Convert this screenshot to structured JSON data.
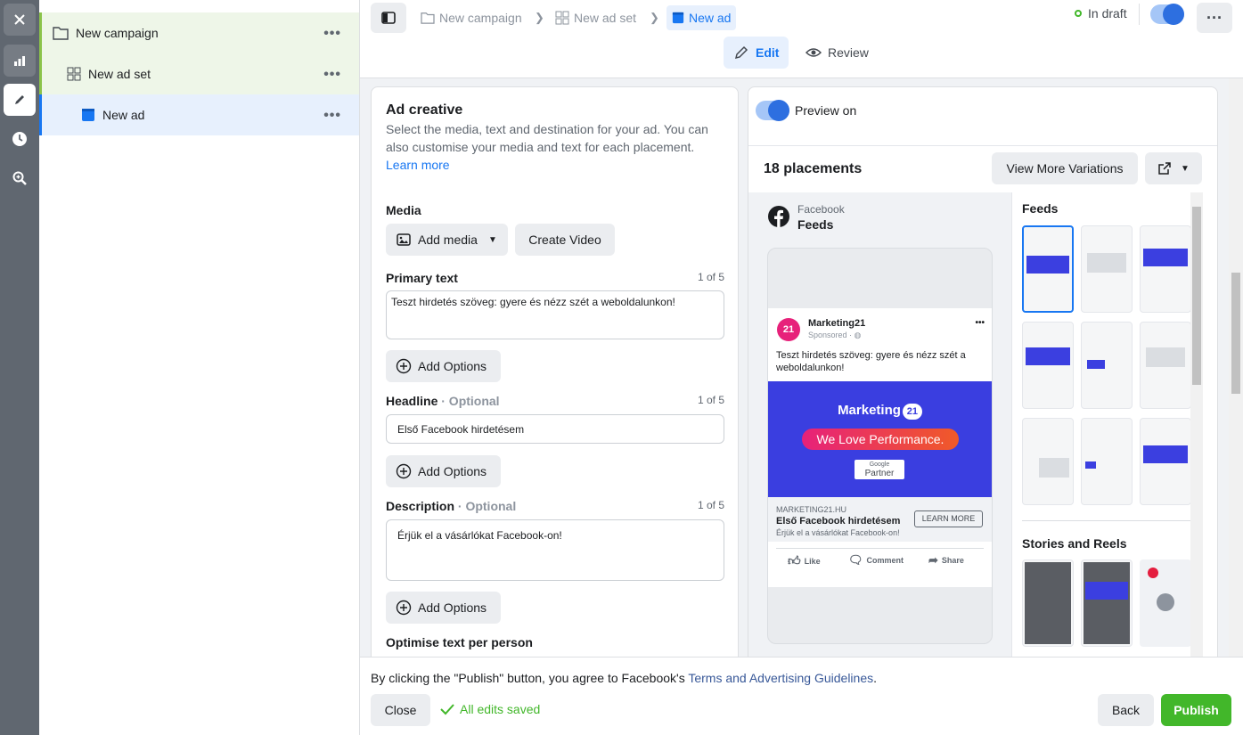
{
  "rail": {
    "icons": [
      "close-icon",
      "chart-icon",
      "pencil-icon",
      "clock-icon",
      "search-zoom-icon"
    ]
  },
  "tree": {
    "campaign_label": "New campaign",
    "adset_label": "New ad set",
    "ad_label": "New ad",
    "more_glyph": "•••"
  },
  "topbar": {
    "breadcrumb_campaign": "New campaign",
    "breadcrumb_adset": "New ad set",
    "breadcrumb_ad": "New ad",
    "status": "In draft",
    "more_glyph": "···",
    "tab_edit": "Edit",
    "tab_review": "Review"
  },
  "ad_creative": {
    "title": "Ad creative",
    "description": "Select the media, text and destination for your ad. You can also customise your media and text for each placement.",
    "learn_more": "Learn more",
    "media_label": "Media",
    "add_media": "Add media",
    "create_video": "Create Video",
    "primary_text_label": "Primary text",
    "primary_text_count": "1 of 5",
    "primary_text_value": "Teszt hirdetés szöveg: gyere és nézz szét a weboldalunkon!",
    "add_options": "Add Options",
    "headline_label": "Headline",
    "optional": " · Optional",
    "headline_count": "1 of 5",
    "headline_value": "Első Facebook hirdetésem",
    "description_label": "Description",
    "description_count": "1 of 5",
    "description_value": "Érjük el a vásárlókat Facebook-on!",
    "optimise_label": "Optimise text per person"
  },
  "preview": {
    "toggle_label": "Preview on",
    "placements_count": "18 placements",
    "view_more": "View More Variations",
    "platform": "Facebook",
    "placement": "Feeds",
    "post": {
      "page_name": "Marketing21",
      "sponsored": "Sponsored · ",
      "more_glyph": "•••",
      "text": "Teszt hirdetés szöveg: gyere és nézz szét a weboldalunkon!",
      "banner_brand": "Marketing",
      "banner_brand_num": "21",
      "banner_tagline": "We Love Performance.",
      "banner_badge_top": "Google",
      "banner_badge_bottom": "Partner",
      "domain": "MARKETING21.HU",
      "headline": "Első Facebook hirdetésem",
      "description": "Érjük el a vásárlókat Facebook-on!",
      "cta": "LEARN MORE",
      "like": "Like",
      "comment": "Comment",
      "share": "Share"
    },
    "feeds_heading": "Feeds",
    "stories_heading": "Stories and Reels"
  },
  "footer": {
    "notice_prefix": "By clicking the \"Publish\" button, you agree to Facebook's ",
    "notice_link": "Terms and Advertising Guidelines",
    "notice_suffix": ".",
    "close": "Close",
    "saved": "All edits saved",
    "back": "Back",
    "publish": "Publish"
  },
  "colors": {
    "accent": "#1877f2",
    "publish": "#42b72a",
    "saved": "#42b72a",
    "rail": "#606770",
    "banner": "#3b3fe0"
  }
}
